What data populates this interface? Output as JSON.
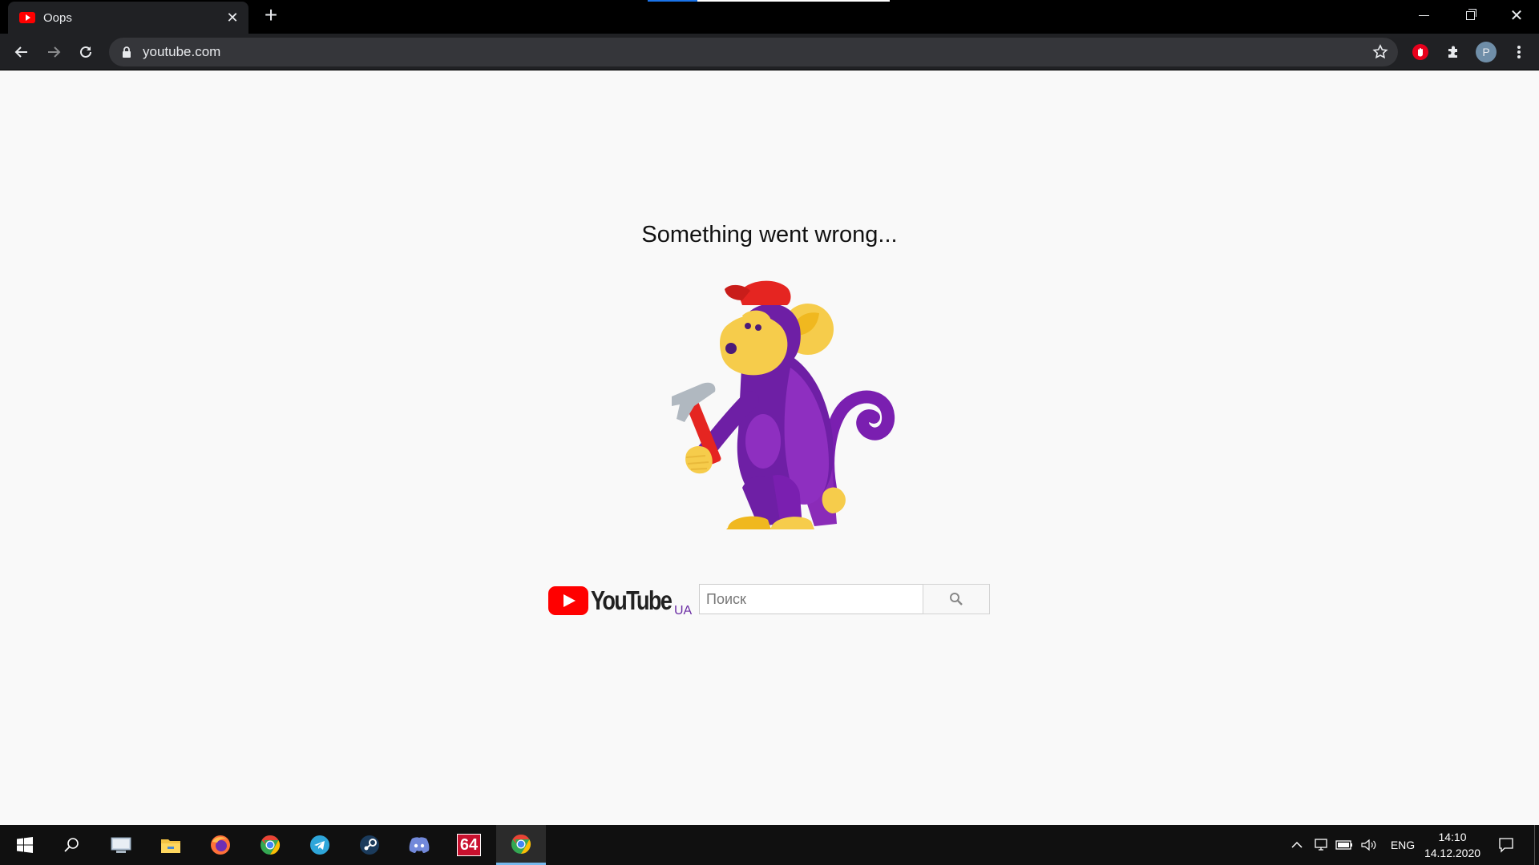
{
  "browser": {
    "tab": {
      "title": "Oops",
      "close_glyph": "✕"
    },
    "new_tab_glyph": "+",
    "window_close_glyph": "✕",
    "omnibox": {
      "url": "youtube.com"
    },
    "profile_initial": "P",
    "icons": [
      "back-arrow-icon",
      "forward-arrow-icon",
      "reload-icon",
      "lock-icon",
      "star-icon",
      "adblock-icon",
      "puzzle-icon",
      "menu-dots-icon"
    ]
  },
  "page": {
    "title": "Something went wrong...",
    "logo": {
      "wordmark": "YouTube",
      "country": "UA"
    },
    "search": {
      "placeholder": "Поиск",
      "value": ""
    },
    "colors": {
      "brand_red": "#ff0000",
      "monkey_purple": "#6e1fa5",
      "monkey_yellow": "#f6cc4b",
      "cap_red": "#e52521"
    }
  },
  "taskbar": {
    "apps": [
      "windows-start-icon",
      "search-icon",
      "pc-icon",
      "file-explorer-icon",
      "firefox-icon",
      "chrome-icon",
      "telegram-icon",
      "steam-icon",
      "discord-icon",
      "aida64-icon",
      "chrome-active-icon"
    ],
    "aida_label": "64",
    "language": "ENG",
    "time": "14:10",
    "date": "14.12.2020"
  }
}
